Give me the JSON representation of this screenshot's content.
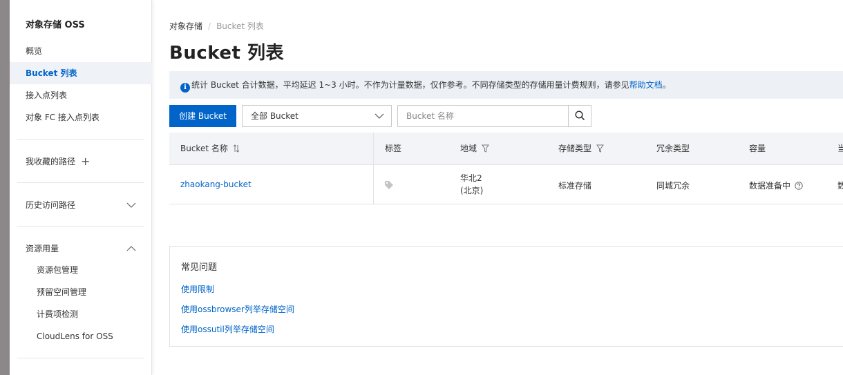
{
  "sidebar": {
    "title": "对象存储 OSS",
    "items": [
      {
        "label": "概览"
      },
      {
        "label": "Bucket 列表"
      },
      {
        "label": "接入点列表"
      },
      {
        "label": "对象 FC 接入点列表"
      }
    ],
    "favorites": {
      "label": "我收藏的路径",
      "icon": "plus-icon"
    },
    "history": {
      "label": "历史访问路径",
      "icon": "chevron-down-icon"
    },
    "resources": {
      "label": "资源用量",
      "icon": "chevron-up-icon",
      "items": [
        {
          "label": "资源包管理"
        },
        {
          "label": "预留空间管理"
        },
        {
          "label": "计费项检测"
        },
        {
          "label": "CloudLens for OSS"
        }
      ]
    }
  },
  "breadcrumb": {
    "root": "对象存储",
    "sep": "/",
    "current": "Bucket 列表"
  },
  "page_title": "Bucket 列表",
  "notice": {
    "icon": "info-icon",
    "text": "统计 Bucket 合计数据，平均延迟 1~3 小时。不作为计量数据，仅作参考。不同存储类型的存储用量计费规则，请参见",
    "link": "帮助文档",
    "end": "。"
  },
  "toolbar": {
    "create_label": "创建 Bucket",
    "filter_value": "全部 Bucket",
    "search_placeholder": "Bucket 名称"
  },
  "table": {
    "columns": {
      "name": "Bucket 名称",
      "tags": "标签",
      "region": "地域",
      "storage_class": "存储类型",
      "redundancy": "冗余类型",
      "capacity": "容量",
      "partial": "当"
    },
    "rows": [
      {
        "name": "zhaokang-bucket",
        "region_line1": "华北2",
        "region_line2": "(北京)",
        "storage_class": "标准存储",
        "redundancy": "同城冗余",
        "capacity": "数据准备中",
        "partial": "数"
      }
    ]
  },
  "faq": {
    "title": "常见问题",
    "links": [
      {
        "label": "使用限制"
      },
      {
        "label": "使用ossbrowser列举存储空间"
      },
      {
        "label": "使用ossutil列举存储空间"
      }
    ]
  },
  "colors": {
    "primary": "#0064c8",
    "active_bg": "#eff3f8",
    "header_bg": "#f2f4f7",
    "notice_bg": "#edf1f6"
  }
}
